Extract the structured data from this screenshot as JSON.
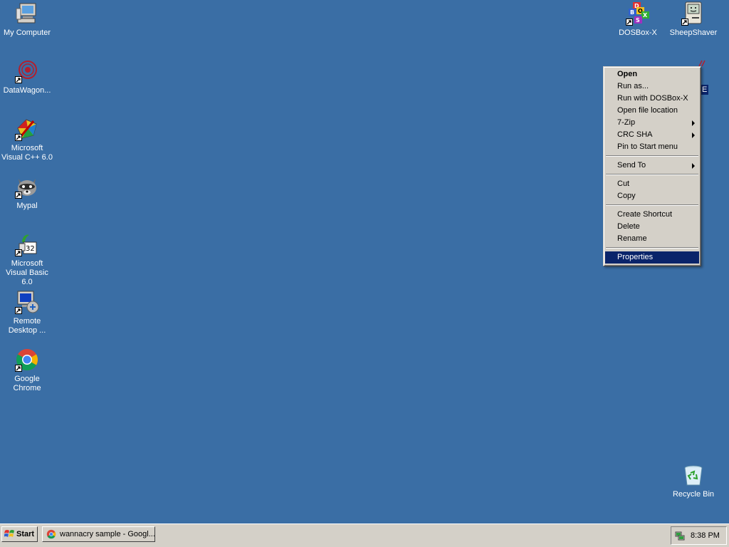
{
  "desktop": {
    "background": "#3a6ea5",
    "icons": [
      {
        "label": "My Computer",
        "icon": "computer-icon",
        "shortcut": false
      },
      {
        "label": "DataWagon...",
        "icon": "datawagon-icon",
        "shortcut": true
      },
      {
        "label": "Microsoft Visual C++ 6.0",
        "icon": "visual-cpp-icon",
        "shortcut": true
      },
      {
        "label": "Mypal",
        "icon": "raccoon-icon",
        "shortcut": true
      },
      {
        "label": "Microsoft Visual Basic 6.0",
        "icon": "visual-basic-icon",
        "shortcut": true
      },
      {
        "label": "Remote Desktop ...",
        "icon": "remote-desktop-icon",
        "shortcut": true
      },
      {
        "label": "Google Chrome",
        "icon": "chrome-icon",
        "shortcut": true
      },
      {
        "label": "DOSBox-X",
        "icon": "dosbox-icon",
        "shortcut": true
      },
      {
        "label": "SheepShaver",
        "icon": "mac-icon",
        "shortcut": true
      },
      {
        "label": "Recycle Bin",
        "icon": "recycle-bin-icon",
        "shortcut": false
      }
    ],
    "partial_icon_text": "E"
  },
  "context_menu": {
    "items": [
      {
        "label": "Open",
        "bold": true
      },
      {
        "label": "Run as..."
      },
      {
        "label": "Run with DOSBox-X"
      },
      {
        "label": "Open file location"
      },
      {
        "label": "7-Zip",
        "submenu": true
      },
      {
        "label": "CRC SHA",
        "submenu": true
      },
      {
        "label": "Pin to Start menu"
      },
      {
        "separator": true
      },
      {
        "label": "Send To",
        "submenu": true
      },
      {
        "separator": true
      },
      {
        "label": "Cut"
      },
      {
        "label": "Copy"
      },
      {
        "separator": true
      },
      {
        "label": "Create Shortcut"
      },
      {
        "label": "Delete"
      },
      {
        "label": "Rename"
      },
      {
        "separator": true
      },
      {
        "label": "Properties",
        "selected": true
      }
    ],
    "highlight_color": "#0a246a"
  },
  "taskbar": {
    "start_label": "Start",
    "tasks": [
      {
        "label": "wannacry sample - Googl...",
        "icon": "chrome-icon"
      }
    ],
    "clock": "8:38 PM",
    "tray_icon": "network-icon"
  }
}
